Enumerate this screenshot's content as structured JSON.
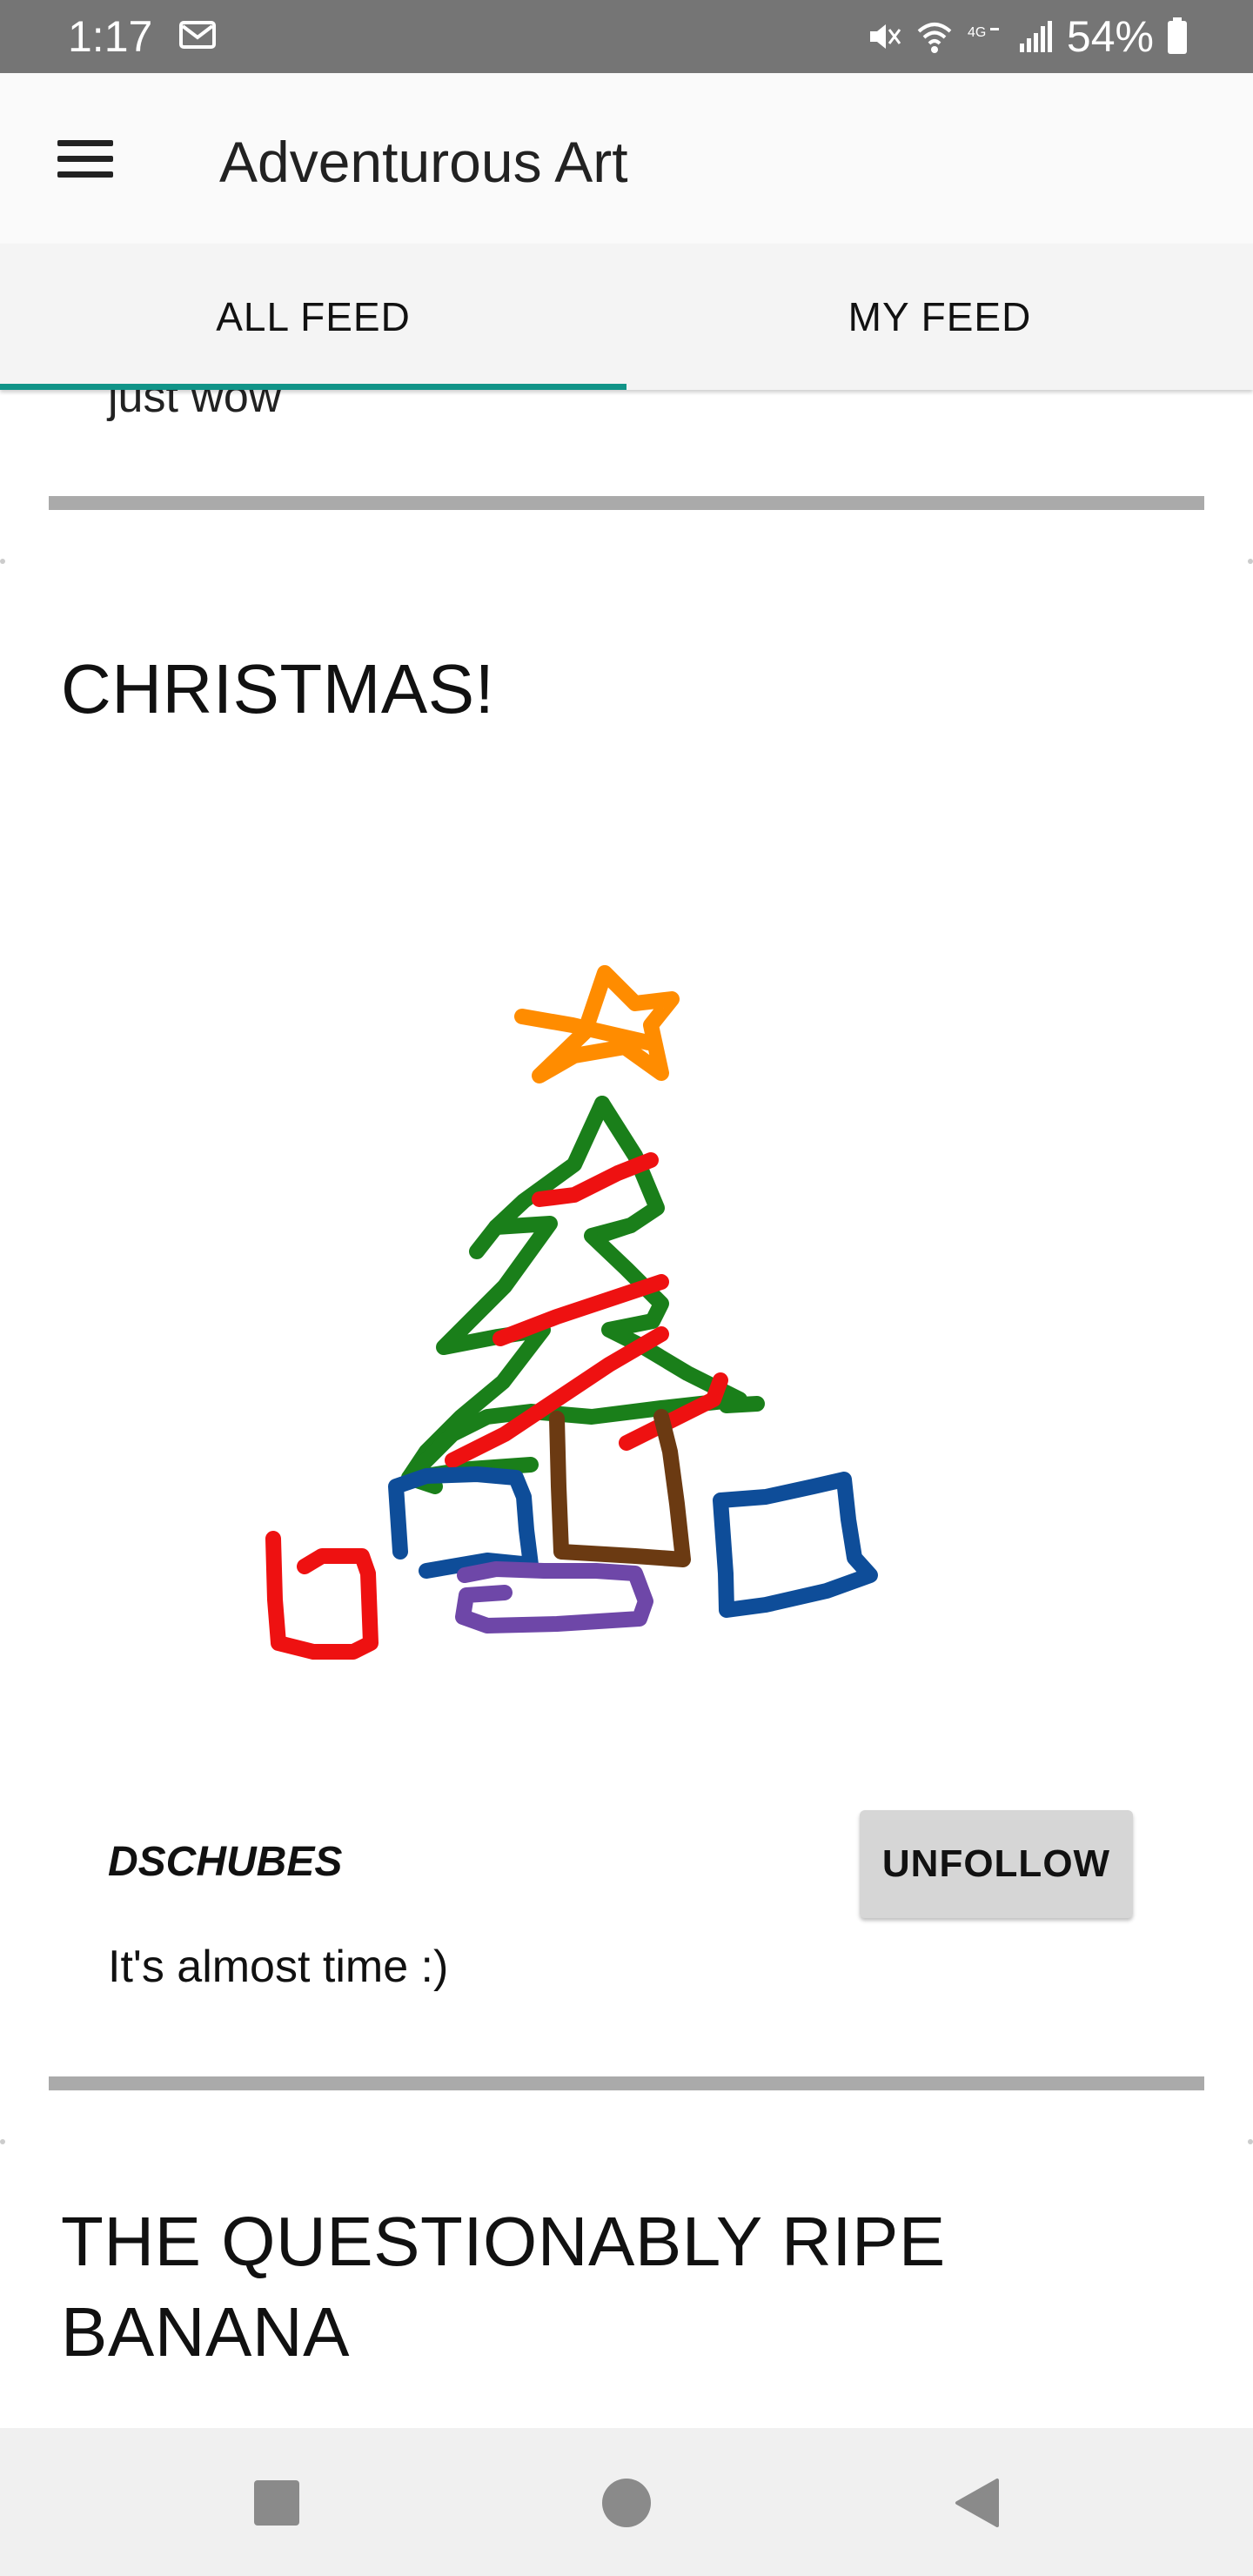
{
  "status_bar": {
    "time": "1:17",
    "battery_percent": "54%",
    "icons": [
      "mail-icon",
      "mute-icon",
      "wifi-icon",
      "lte-icon",
      "signal-icon",
      "battery-icon"
    ]
  },
  "app_bar": {
    "title": "Adventurous Art",
    "menu_icon": "hamburger-menu-icon"
  },
  "tabs": [
    {
      "label": "ALL FEED",
      "selected": true
    },
    {
      "label": "MY FEED",
      "selected": false
    }
  ],
  "accent_color": "#119488",
  "feed": {
    "previous_post_comment": "just wow",
    "posts": [
      {
        "title": "CHRISTMAS!",
        "author": "DSCHUBES",
        "follow_button": "UNFOLLOW",
        "caption": "It's almost time :)",
        "image": "christmas-tree-drawing"
      },
      {
        "title": "THE QUESTIONABLY RIPE BANANA"
      }
    ]
  },
  "nav_bar": {
    "buttons": [
      "recent-apps-icon",
      "home-icon",
      "back-icon"
    ]
  }
}
